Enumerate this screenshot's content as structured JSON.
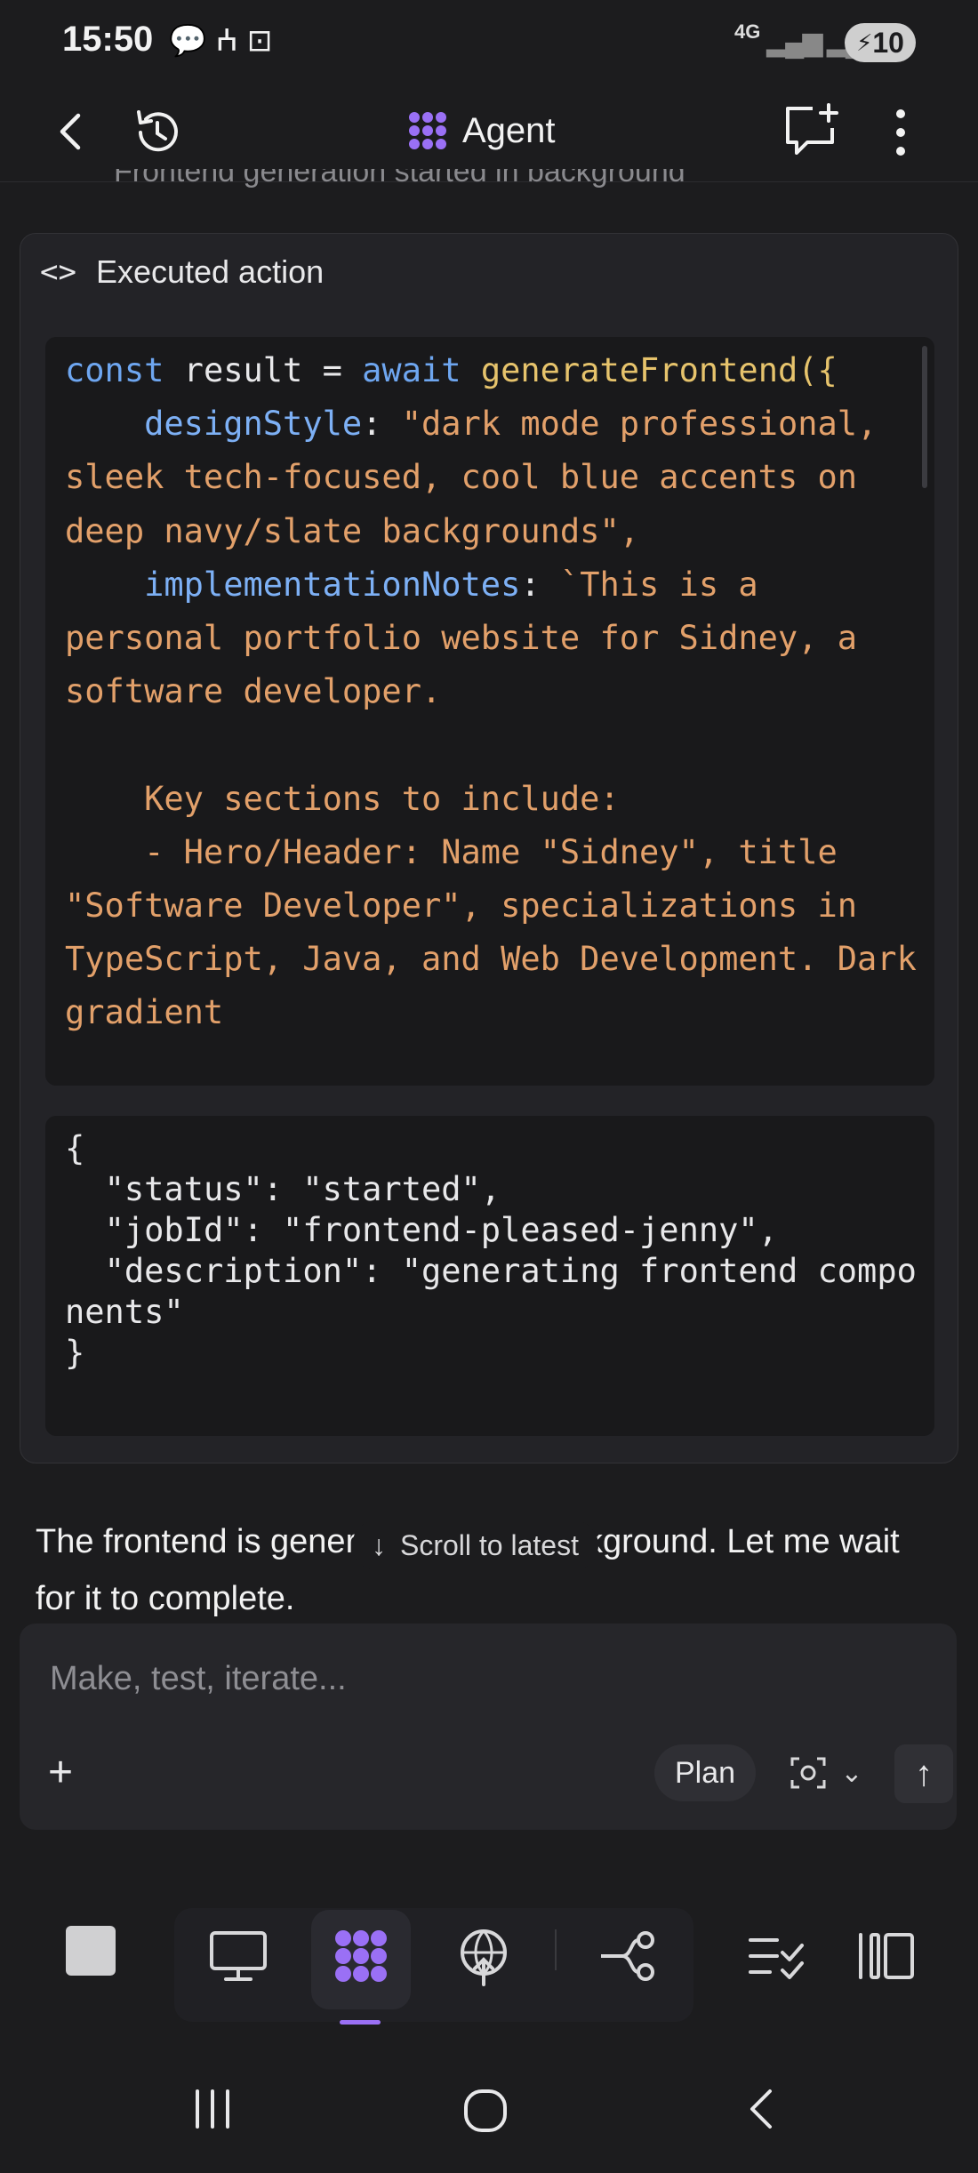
{
  "status_bar": {
    "time": "15:50",
    "network": "4G",
    "battery": "10"
  },
  "header": {
    "title": "Agent",
    "brand_color": "#9a70f5"
  },
  "previous_step": {
    "label": "Frontend generation started in background"
  },
  "action_card": {
    "header_label": "Executed action",
    "code": {
      "keyword_const": "const",
      "var_name": " result = ",
      "keyword_await": "await",
      "fn_name": "generateFrontend",
      "open": "({",
      "prop_design": "designStyle",
      "design_value": "\"dark mode professional, sleek tech-focused, cool blue accents on deep navy/slate backgrounds\",",
      "prop_impl": "implementationNotes",
      "impl_value_1": "`This is a personal portfolio website for Sidney, a software developer.",
      "impl_value_2": "Key sections to include:",
      "impl_value_3": "- Hero/Header: Name \"Sidney\", title \"Software Developer\", specializations in TypeScript, Java, and Web Development. Dark gradient"
    },
    "result": "{\n  \"status\": \"started\",\n  \"jobId\": \"frontend-pleased-jenny\",\n  \"description\": \"generating frontend components\"\n}"
  },
  "message": {
    "text": "The frontend is generating in the background. Let me wait for it to complete."
  },
  "scroll_to_latest": {
    "label": "Scroll to latest"
  },
  "composer": {
    "placeholder": "Make, test, iterate...",
    "plan_label": "Plan"
  },
  "toolbar": {
    "items": [
      "stop",
      "desktop-preview",
      "agent",
      "deploy",
      "git",
      "tasks",
      "panels"
    ],
    "active": "agent"
  }
}
